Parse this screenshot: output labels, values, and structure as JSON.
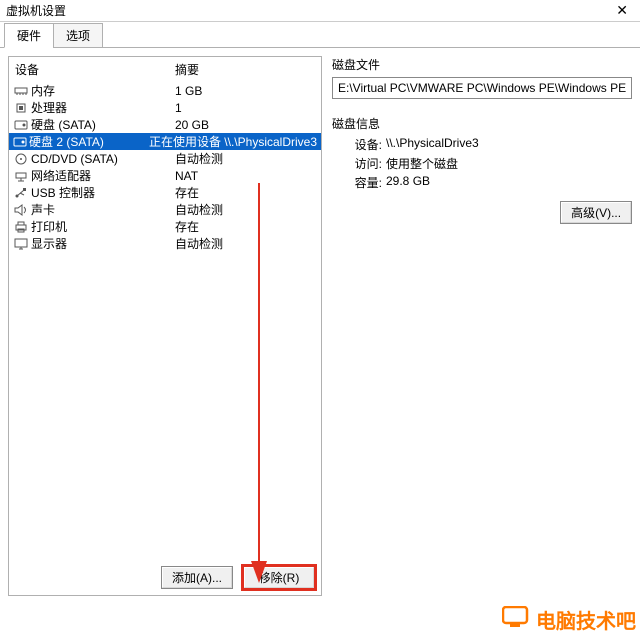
{
  "window": {
    "title": "虚拟机设置"
  },
  "tabs": {
    "hardware": "硬件",
    "options": "选项"
  },
  "columns": {
    "device": "设备",
    "summary": "摘要"
  },
  "devices": [
    {
      "icon": "memory",
      "name": "内存",
      "summary": "1 GB"
    },
    {
      "icon": "cpu",
      "name": "处理器",
      "summary": "1"
    },
    {
      "icon": "disk",
      "name": "硬盘 (SATA)",
      "summary": "20 GB"
    },
    {
      "icon": "disk",
      "name": "硬盘 2 (SATA)",
      "summary": "正在使用设备 \\\\.\\PhysicalDrive3",
      "selected": true
    },
    {
      "icon": "cd",
      "name": "CD/DVD (SATA)",
      "summary": "自动检测"
    },
    {
      "icon": "network",
      "name": "网络适配器",
      "summary": "NAT"
    },
    {
      "icon": "usb",
      "name": "USB 控制器",
      "summary": "存在"
    },
    {
      "icon": "sound",
      "name": "声卡",
      "summary": "自动检测"
    },
    {
      "icon": "printer",
      "name": "打印机",
      "summary": "存在"
    },
    {
      "icon": "display",
      "name": "显示器",
      "summary": "自动检测"
    }
  ],
  "buttons": {
    "add": "添加(A)...",
    "remove": "移除(R)",
    "advanced": "高级(V)..."
  },
  "right": {
    "disk_file_title": "磁盘文件",
    "disk_file_value": "E:\\Virtual PC\\VMWARE PC\\Windows PE\\Windows PE",
    "disk_info_title": "磁盘信息",
    "info_device_label": "设备:",
    "info_device_value": "\\\\.\\PhysicalDrive3",
    "info_access_label": "访问:",
    "info_access_value": "使用整个磁盘",
    "info_capacity_label": "容量:",
    "info_capacity_value": "29.8 GB"
  },
  "watermark": "电脑技术吧"
}
